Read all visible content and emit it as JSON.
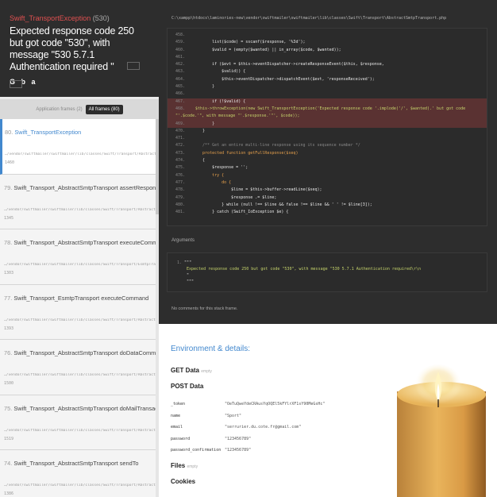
{
  "exception": {
    "class": "Swift_TransportException",
    "code": "(530)",
    "message": "Expected response code 250 but got code \"530\", with message \"530 5.7.1 Authentication required \"",
    "icons": [
      "G",
      "b",
      "a"
    ]
  },
  "filter": {
    "app_frames": "Application frames (2)",
    "all_frames": "All frames (80)"
  },
  "frames": [
    {
      "index": "80.",
      "title": "Swift_TransportException",
      "file": "…/vendor/swiftmailer/swiftmailer/lib/classes/Swift/Transport/AbstractSmtpTransport",
      "line": "1460"
    },
    {
      "index": "79.",
      "title": "Swift_Transport_AbstractSmtpTransport assertResponseCode",
      "file": "…/vendor/swiftmailer/swiftmailer/lib/classes/Swift/Transport/AbstractSmtpTransport",
      "line": "1345"
    },
    {
      "index": "78.",
      "title": "Swift_Transport_AbstractSmtpTransport executeCommand",
      "file": "…/vendor/swiftmailer/swiftmailer/lib/classes/Swift/Transport/EsmtpTransport.php",
      "line": "1303"
    },
    {
      "index": "77.",
      "title": "Swift_Transport_EsmtpTransport executeCommand",
      "file": "…/vendor/swiftmailer/swiftmailer/lib/classes/Swift/Transport/AbstractSmtpTransport",
      "line": "1393"
    },
    {
      "index": "76.",
      "title": "Swift_Transport_AbstractSmtpTransport doDataCommand",
      "file": "…/vendor/swiftmailer/swiftmailer/lib/classes/Swift/Transport/AbstractSmtpTransport",
      "line": "1500"
    },
    {
      "index": "75.",
      "title": "Swift_Transport_AbstractSmtpTransport doMailTransaction",
      "file": "…/vendor/swiftmailer/swiftmailer/lib/classes/Swift/Transport/AbstractSmtpTransport",
      "line": "1519"
    },
    {
      "index": "74.",
      "title": "Swift_Transport_AbstractSmtpTransport sendTo",
      "file": "…/vendor/swiftmailer/swiftmailer/lib/classes/Swift/Transport/AbstractSmtpTransport",
      "line": "1386"
    }
  ],
  "file_path": "C:\\xampp\\htdocs\\laminories-new\\vendor\\swiftmailer\\swiftmailer\\lib\\classes\\Swift\\Transport\\AbstractSmtpTransport.php",
  "code_lines": [
    {
      "n": "458.",
      "t": ""
    },
    {
      "n": "459.",
      "t": "        list($code) = sscanf($response, '%3d');"
    },
    {
      "n": "460.",
      "t": "        $valid = (empty($wanted) || in_array($code, $wanted));"
    },
    {
      "n": "461.",
      "t": ""
    },
    {
      "n": "462.",
      "t": "        if ($evt = $this->eventDispatcher->createResponseEvent($this, $response,"
    },
    {
      "n": "463.",
      "t": "            $valid)) {"
    },
    {
      "n": "464.",
      "t": "            $this->eventDispatcher->dispatchEvent($evt, 'responseReceived');"
    },
    {
      "n": "465.",
      "t": "        }"
    },
    {
      "n": "466.",
      "t": ""
    },
    {
      "n": "467.",
      "t": "        if (!$valid) {"
    },
    {
      "n": "468.",
      "t": "            $this->throwException(new Swift_TransportException('Expected response code '.implode('/', $wanted).' but got code \"'.$code.'\", with message \"'.$response.'\"', $code));"
    },
    {
      "n": "469.",
      "t": "        }"
    },
    {
      "n": "470.",
      "t": "    }"
    },
    {
      "n": "471.",
      "t": ""
    },
    {
      "n": "472.",
      "t": "    /** Get an entire multi-line response using its sequence number */"
    },
    {
      "n": "473.",
      "t": "    protected function getFullResponse($seq)"
    },
    {
      "n": "474.",
      "t": "    {"
    },
    {
      "n": "475.",
      "t": "        $response = '';"
    },
    {
      "n": "476.",
      "t": "        try {"
    },
    {
      "n": "477.",
      "t": "            do {"
    },
    {
      "n": "478.",
      "t": "                $line = $this->buffer->readLine($seq);"
    },
    {
      "n": "479.",
      "t": "                $response .= $line;"
    },
    {
      "n": "480.",
      "t": "            } while (null !== $line && false !== $line && ' ' != $line[3]);"
    },
    {
      "n": "481.",
      "t": "        } catch (Swift_IoException $e) {"
    }
  ],
  "arguments": {
    "label": "Arguments",
    "num": "1.",
    "open": "\"\"\"",
    "text": "Expected response code 250 but got code \"530\", with message \"530 5.7.1 Authentication required\\r\\n",
    "mid": "\"",
    "close": "\"\"\""
  },
  "comments": "No comments for this stack frame.",
  "environment": {
    "title": "Environment & details:",
    "get_data": "GET Data",
    "get_empty": "empty",
    "post_data": "POST Data",
    "post": [
      {
        "key": "_token",
        "value": "\"OeTuQweYdeCRAusYqOQEl5kFYlrXF1sY90MeGsHc\""
      },
      {
        "key": "name",
        "value": "\"Sport\""
      },
      {
        "key": "email",
        "value": "\"serrurier.du.cote.fr@gmail.com\""
      },
      {
        "key": "password",
        "value": "\"123456789\""
      },
      {
        "key": "password_confirmation",
        "value": "\"123456789\""
      }
    ],
    "files": "Files",
    "files_empty": "empty",
    "cookies": "Cookies"
  }
}
